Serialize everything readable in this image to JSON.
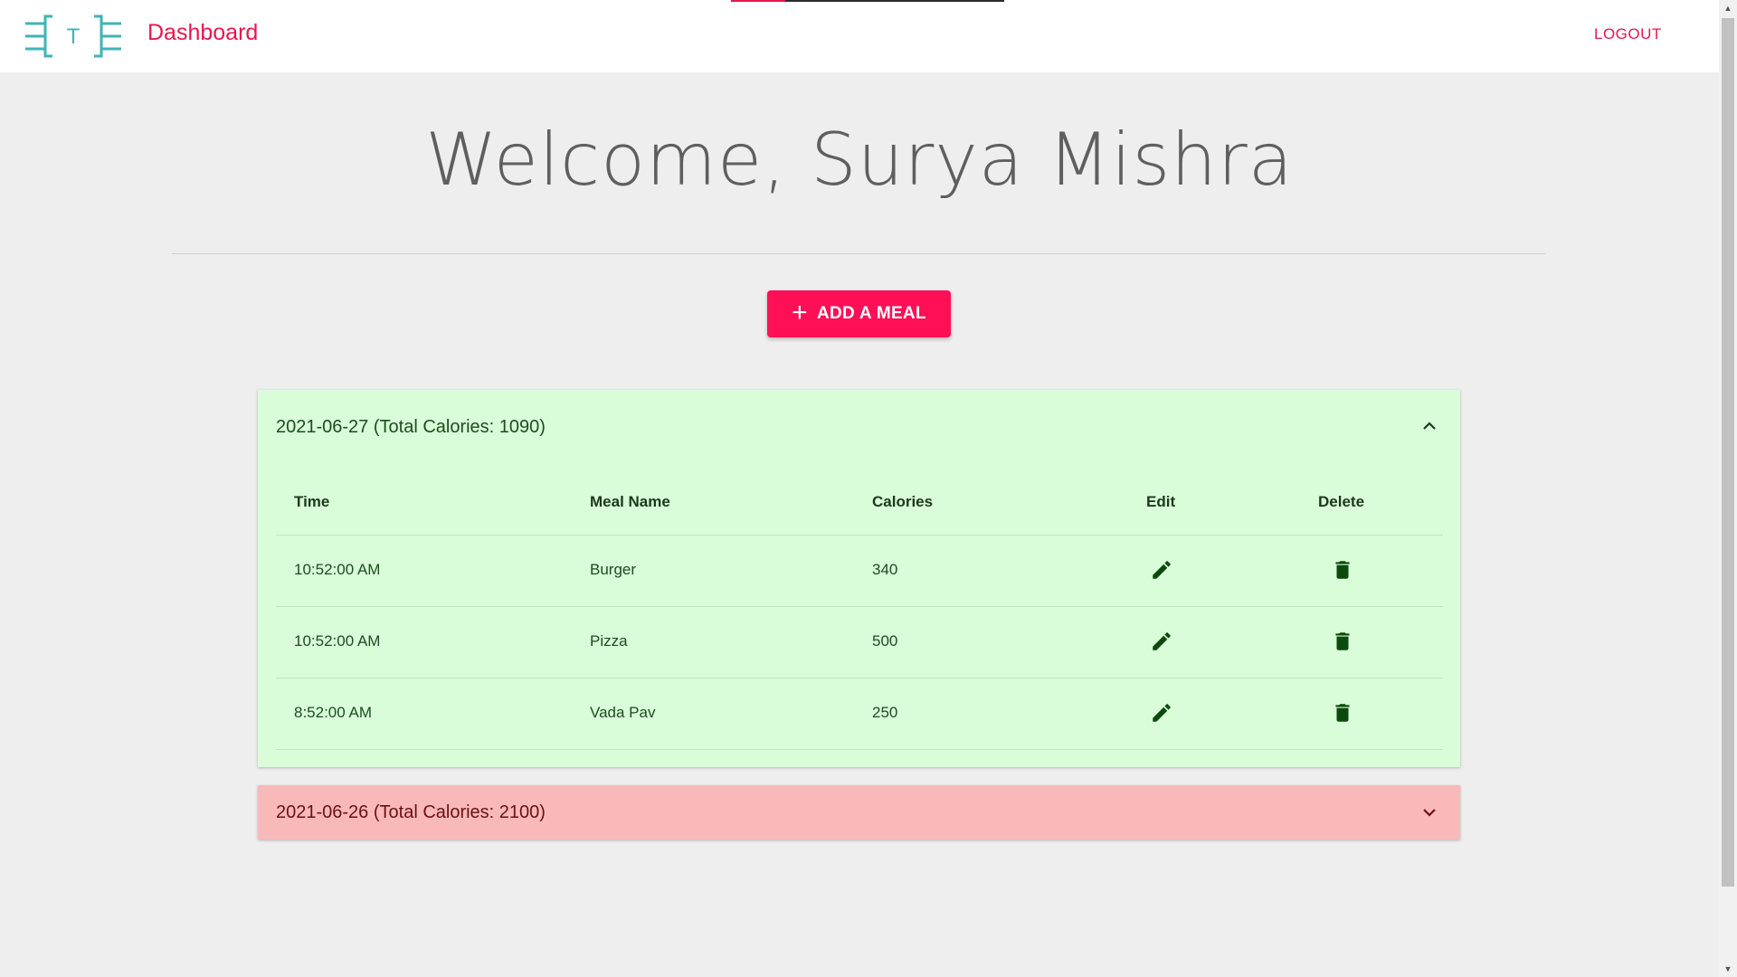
{
  "appbar": {
    "brand": "Dashboard",
    "logo_letter": "T",
    "logout_label": "LOGOUT",
    "progress_fraction": 0.2
  },
  "welcome": "Welcome, Surya Mishra",
  "add_meal_label": "ADD A MEAL",
  "colors": {
    "accent": "#e8164f",
    "button": "#ff0f56",
    "green_panel": "#d9fcd9",
    "red_panel": "#f9b9b9",
    "icon_green": "#0c4a0c",
    "logo_teal": "#3fb4b4"
  },
  "days": [
    {
      "header": "2021-06-27 (Total Calories: 1090)",
      "expanded": true,
      "status": "under-limit",
      "columns": [
        "Time",
        "Meal Name",
        "Calories",
        "Edit",
        "Delete"
      ],
      "rows": [
        {
          "time": "10:52:00 AM",
          "meal": "Burger",
          "calories": "340"
        },
        {
          "time": "10:52:00 AM",
          "meal": "Pizza",
          "calories": "500"
        },
        {
          "time": "8:52:00 AM",
          "meal": "Vada Pav",
          "calories": "250"
        }
      ]
    },
    {
      "header": "2021-06-26 (Total Calories: 2100)",
      "expanded": false,
      "status": "over-limit"
    }
  ],
  "icons": {
    "edit": "pencil-icon",
    "delete": "trash-icon",
    "collapse": "chevron-up-icon",
    "expand": "chevron-down-icon",
    "add": "plus-icon"
  }
}
